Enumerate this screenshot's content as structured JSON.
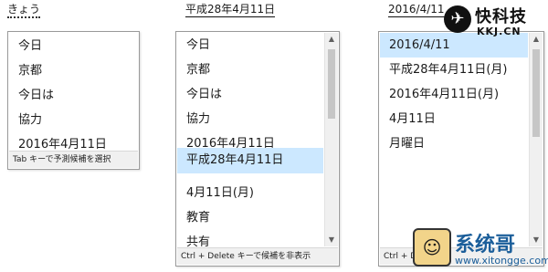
{
  "panel1": {
    "typed_text": "きょう",
    "items": [
      "今日",
      "京都",
      "今日は",
      "協力",
      "2016年4月11日"
    ],
    "footer": "Tab キーで予測候補を選択"
  },
  "panel2": {
    "typed_text": "平成28年4月11日",
    "items": [
      "今日",
      "京都",
      "今日は",
      "協力",
      "2016年4月11日",
      "平成28年4月11日",
      "4月11日(月)",
      "教育",
      "共有"
    ],
    "selected_index": 5,
    "footer": "Ctrl + Delete キーで候補を非表示"
  },
  "panel3": {
    "typed_text": "2016/4/11",
    "items": [
      "2016/4/11",
      "平成28年4月11日(月)",
      "2016年4月11日(月)",
      "4月11日",
      "月曜日"
    ],
    "selected_index": 0,
    "footer": "Ctrl + D"
  },
  "watermark_top": {
    "title": "快科技",
    "subtitle": "KKJ.CN"
  },
  "watermark_bottom": {
    "title": "系统哥",
    "url": "www.xitongge.com"
  },
  "colors": {
    "selection": "#cce8ff",
    "footer_bg": "#f0f0f0",
    "border": "#9a9a9a"
  }
}
